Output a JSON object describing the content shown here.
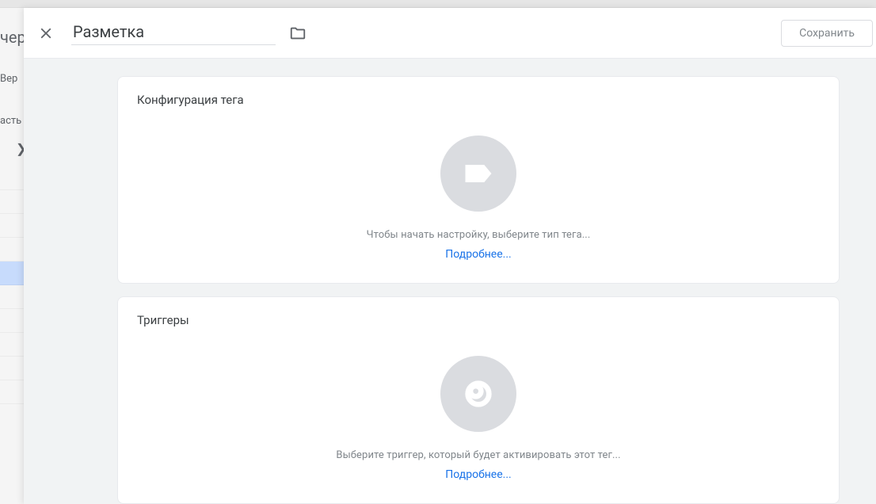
{
  "bg": {
    "t1": "чер",
    "t2": "Вер",
    "t3": "асть"
  },
  "header": {
    "title_value": "Разметка",
    "save_label": "Сохранить"
  },
  "cards": {
    "config": {
      "title": "Конфигурация тега",
      "hint": "Чтобы начать настройку, выберите тип тега...",
      "learn_more": "Подробнее..."
    },
    "triggers": {
      "title": "Триггеры",
      "hint": "Выберите триггер, который будет активировать этот тег...",
      "learn_more": "Подробнее..."
    }
  }
}
